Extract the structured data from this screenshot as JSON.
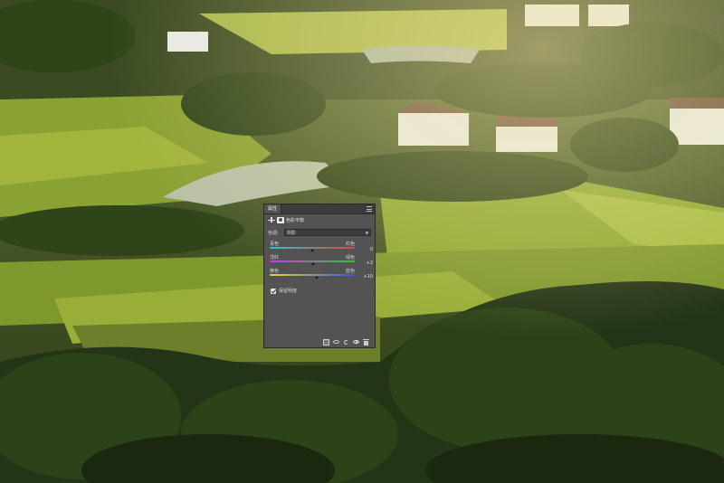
{
  "panel": {
    "tab_label": "属性",
    "title": "色彩平衡",
    "tone": {
      "label": "色调:",
      "value": "阴影"
    },
    "sliders": [
      {
        "left": "青色",
        "right": "红色",
        "value": "0",
        "position": 0.5,
        "gradient": [
          "#22c7d6",
          "#e0463a"
        ]
      },
      {
        "left": "洋红",
        "right": "绿色",
        "value": "+2",
        "position": 0.51,
        "gradient": [
          "#d23ad6",
          "#38c246"
        ]
      },
      {
        "left": "黄色",
        "right": "蓝色",
        "value": "+10",
        "position": 0.55,
        "gradient": [
          "#e7d43a",
          "#3458e0"
        ]
      }
    ],
    "preserve": {
      "label": "保留明度",
      "checked": true
    }
  },
  "icons": {
    "panel_icon": "color-balance-icon",
    "mask_icon": "layer-mask-icon",
    "footer": [
      "clip-to-layer-icon",
      "view-previous-state-icon",
      "reset-icon",
      "visibility-eye-icon",
      "delete-icon"
    ]
  }
}
